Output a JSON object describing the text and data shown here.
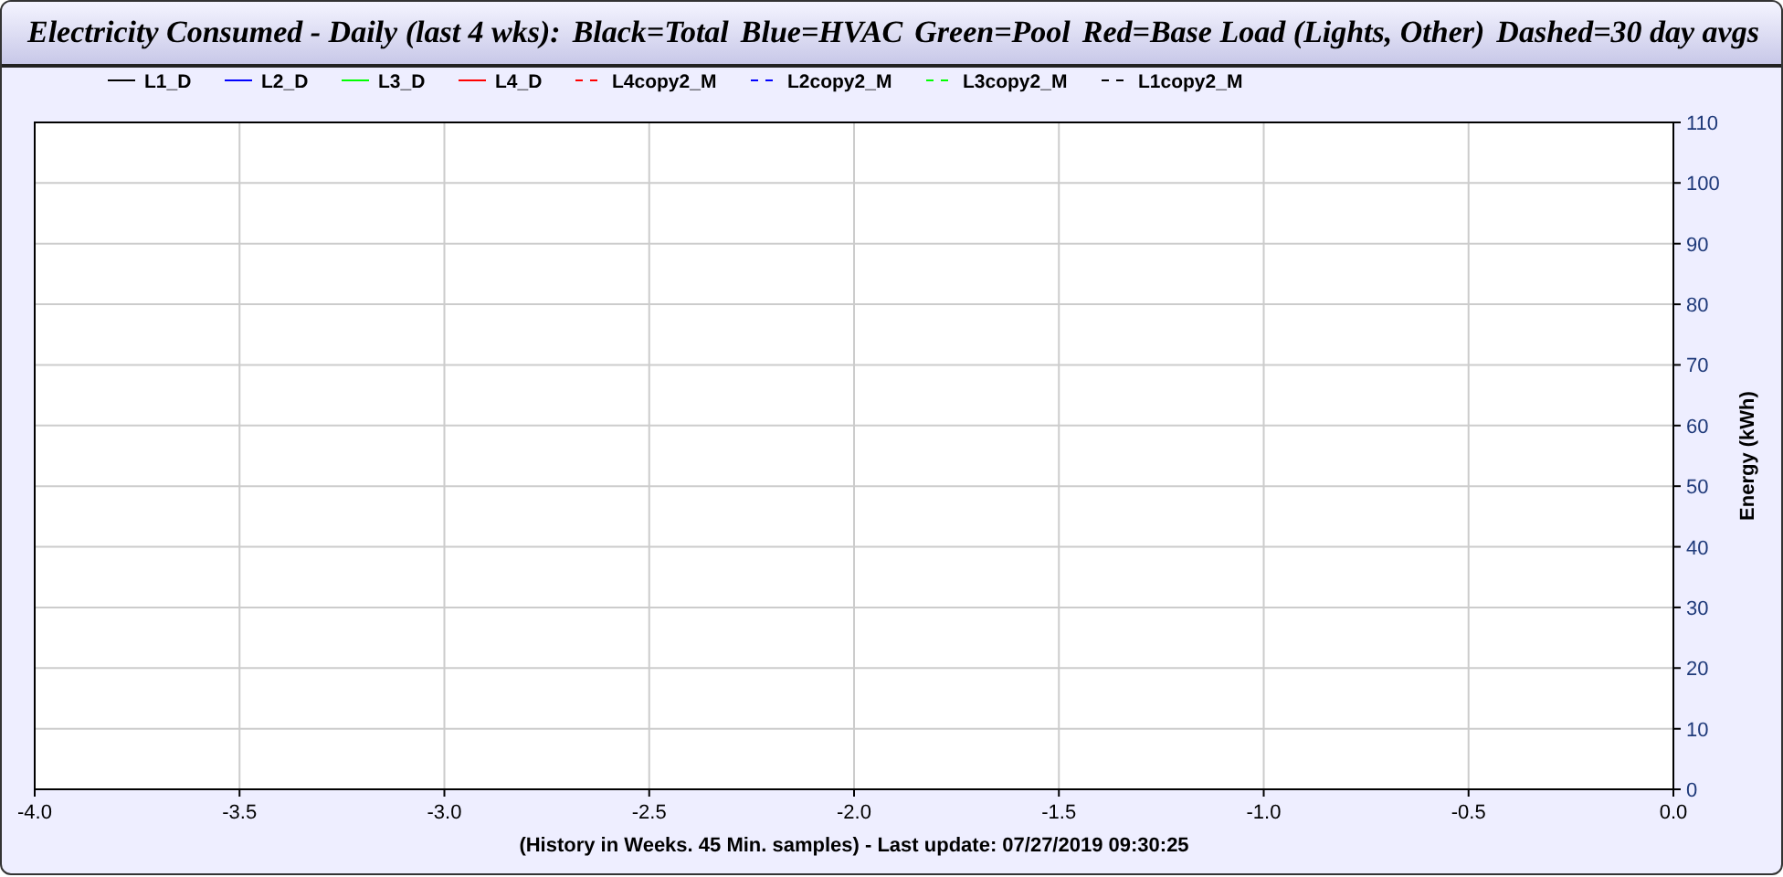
{
  "header": [
    "Electricity Consumed - Daily (last 4 wks):",
    "Black=Total",
    "Blue=HVAC",
    "Green=Pool",
    "Red=Base Load (Lights, Other)",
    "Dashed=30 day avgs"
  ],
  "chart_data": {
    "type": "line",
    "xlabel": "(History in Weeks. 45 Min. samples) - Last update: 07/27/2019 09:30:25",
    "ylabel": "Energy (kWh)",
    "series": [
      {
        "name": "L1_D",
        "color": "#000000",
        "values": [
          null,
          null,
          null,
          null,
          null,
          null,
          null,
          null,
          null
        ]
      },
      {
        "name": "L2_D",
        "color": "#0000ff",
        "values": [
          null,
          null,
          null,
          null,
          null,
          null,
          null,
          null,
          null
        ]
      },
      {
        "name": "L3_D",
        "color": "#00ff00",
        "values": [
          null,
          null,
          null,
          null,
          null,
          null,
          null,
          null,
          null
        ]
      },
      {
        "name": "L4_D",
        "color": "#ff0000",
        "values": [
          null,
          null,
          null,
          null,
          null,
          null,
          null,
          null,
          null
        ]
      },
      {
        "name": "L4copy2_M",
        "color": "#ff0000",
        "values": [
          null,
          null,
          null,
          null,
          null,
          null,
          null,
          null,
          null
        ]
      },
      {
        "name": "L2copy2_M",
        "color": "#0000ff",
        "values": [
          null,
          null,
          null,
          null,
          null,
          null,
          null,
          null,
          null
        ]
      },
      {
        "name": "L3copy2_M",
        "color": "#00ff00",
        "values": [
          null,
          null,
          null,
          null,
          null,
          null,
          null,
          null,
          null
        ]
      },
      {
        "name": "L1copy2_M",
        "color": "#000000",
        "values": [
          null,
          null,
          null,
          null,
          null,
          null,
          null,
          null,
          null
        ]
      }
    ],
    "categories": [
      "-4.0",
      "-3.5",
      "-3.0",
      "-2.5",
      "-2.0",
      "-1.5",
      "-1.0",
      "-0.5",
      "0.0"
    ],
    "ylim": [
      0,
      110
    ],
    "grid": true,
    "yticks": [
      0,
      10,
      20,
      30,
      40,
      50,
      60,
      70,
      80,
      90,
      100,
      110
    ]
  }
}
